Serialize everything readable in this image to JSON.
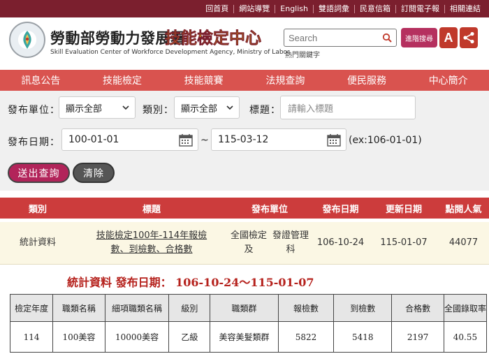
{
  "topbar": {
    "links": [
      "回首頁",
      "網站導覽",
      "English",
      "雙語詞彙",
      "民意信箱",
      "訂閱電子報",
      "相關連結"
    ]
  },
  "header": {
    "org_name": "勞動部勞動力發展署",
    "center_name": "技能檢定中心",
    "org_en": "Skill Evaluation Center of Workforce Development Agency, Ministry of Labor",
    "search_placeholder": "Search",
    "hot_words": "熱門關鍵字",
    "advanced_search": "進階搜尋",
    "font_size_label": "A"
  },
  "nav": {
    "items": [
      "訊息公告",
      "技能檢定",
      "技能競賽",
      "法規查詢",
      "便民服務",
      "中心簡介"
    ]
  },
  "form": {
    "unit_label": "發布單位：",
    "unit_value": "顯示全部",
    "category_label": "類別：",
    "category_value": "顯示全部",
    "title_label": "標題：",
    "title_placeholder": "請輸入標題",
    "date_label": "發布日期：",
    "date_start": "100-01-01",
    "date_sep": "~",
    "date_end": "115-03-12",
    "date_hint": "(ex:106-01-01)",
    "submit_label": "送出查詢",
    "clear_label": "清除"
  },
  "results": {
    "headers": [
      "類別",
      "標題",
      "發布單位",
      "發布日期",
      "更新日期",
      "點閱人氣"
    ],
    "rows": [
      {
        "category": "統計資料",
        "title_line1": "技能檢定100年-114年報檢",
        "title_line2": "數、到檢數、合格數",
        "unit_line1": "全國檢定及",
        "unit_line2": "發證管理科",
        "publish_date": "106-10-24",
        "update_date": "115-01-07",
        "views": "44077"
      }
    ]
  },
  "stats": {
    "title": "統計資料 發布日期： 106-10-24～115-01-07",
    "headers": [
      "檢定年度",
      "職類名稱",
      "細項職類名稱",
      "級別",
      "職類群",
      "報檢數",
      "到檢數",
      "合格數",
      "全國錄取率"
    ],
    "rows": [
      [
        "114",
        "100美容",
        "10000美容",
        "乙級",
        "美容美髮類群",
        "5822",
        "5418",
        "2197",
        "40.55"
      ]
    ]
  },
  "colors": {
    "topbar": "#7b1f2e",
    "nav": "#d9534f",
    "accent": "#b2245a",
    "table_header": "#cc3c3c",
    "stat_title": "#b5211c"
  }
}
